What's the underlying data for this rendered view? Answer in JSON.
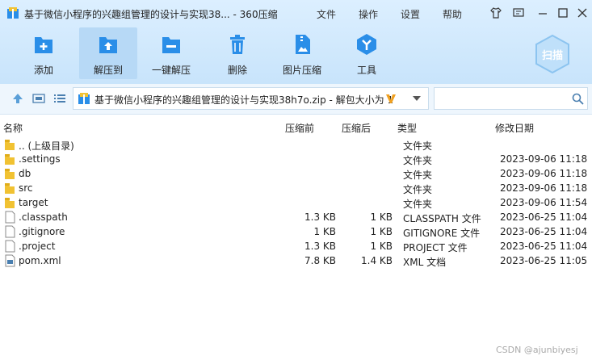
{
  "window": {
    "title": "基于微信小程序的兴趣组管理的设计与实现38... - 360压缩",
    "menus": [
      "文件",
      "操作",
      "设置",
      "帮助"
    ]
  },
  "toolbar": [
    {
      "label": "添加",
      "icon": "add-file-icon"
    },
    {
      "label": "解压到",
      "icon": "extract-to-icon"
    },
    {
      "label": "一键解压",
      "icon": "one-click-extract-icon"
    },
    {
      "label": "删除",
      "icon": "trash-icon"
    },
    {
      "label": "图片压缩",
      "icon": "image-compress-icon"
    },
    {
      "label": "工具",
      "icon": "tools-icon"
    }
  ],
  "scan_label": "扫描",
  "address": {
    "path": "基于微信小程序的兴趣组管理的设计与实现38h7o.zip - 解包大小为 1"
  },
  "columns": {
    "name": "名称",
    "before": "压缩前",
    "after": "压缩后",
    "type": "类型",
    "date": "修改日期"
  },
  "files": [
    {
      "name": ".. (上级目录)",
      "before": "",
      "after": "",
      "type": "文件夹",
      "date": "",
      "icon": "folder-icon"
    },
    {
      "name": ".settings",
      "before": "",
      "after": "",
      "type": "文件夹",
      "date": "2023-09-06 11:18",
      "icon": "folder-icon"
    },
    {
      "name": "db",
      "before": "",
      "after": "",
      "type": "文件夹",
      "date": "2023-09-06 11:18",
      "icon": "folder-icon"
    },
    {
      "name": "src",
      "before": "",
      "after": "",
      "type": "文件夹",
      "date": "2023-09-06 11:18",
      "icon": "folder-icon"
    },
    {
      "name": "target",
      "before": "",
      "after": "",
      "type": "文件夹",
      "date": "2023-09-06 11:54",
      "icon": "folder-icon"
    },
    {
      "name": ".classpath",
      "before": "1.3 KB",
      "after": "1 KB",
      "type": "CLASSPATH 文件",
      "date": "2023-06-25 11:04",
      "icon": "file-icon"
    },
    {
      "name": ".gitignore",
      "before": "1 KB",
      "after": "1 KB",
      "type": "GITIGNORE 文件",
      "date": "2023-06-25 11:04",
      "icon": "file-icon"
    },
    {
      "name": ".project",
      "before": "1.3 KB",
      "after": "1 KB",
      "type": "PROJECT 文件",
      "date": "2023-06-25 11:04",
      "icon": "file-icon"
    },
    {
      "name": "pom.xml",
      "before": "7.8 KB",
      "after": "1.4 KB",
      "type": "XML 文档",
      "date": "2023-06-25 11:05",
      "icon": "xml-file-icon"
    }
  ],
  "watermark": "CSDN @ajunbiyesj",
  "colors": {
    "accent": "#2a8ee8",
    "folder": "#f1c232",
    "ribbon": "#cfe7fb"
  }
}
